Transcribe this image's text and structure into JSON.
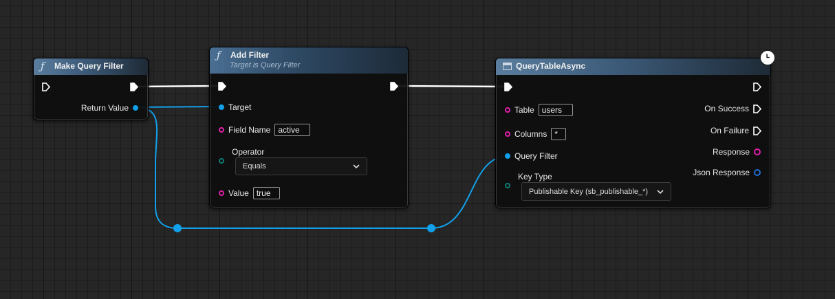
{
  "nodes": {
    "make_query_filter": {
      "title": "Make Query Filter",
      "outputs": {
        "return_value": "Return Value"
      }
    },
    "add_filter": {
      "title": "Add Filter",
      "subtitle": "Target is Query Filter",
      "inputs": {
        "target": "Target",
        "field_name": "Field Name",
        "field_name_value": "active",
        "operator": "Operator",
        "operator_value": "Equals",
        "value": "Value",
        "value_value": "true"
      }
    },
    "query_table_async": {
      "title": "QueryTableAsync",
      "inputs": {
        "table": "Table",
        "table_value": "users",
        "columns": "Columns",
        "columns_value": "*",
        "query_filter": "Query Filter",
        "key_type": "Key Type",
        "key_type_value": "Publishable Key (sb_publishable_*)"
      },
      "outputs": {
        "on_success": "On Success",
        "on_failure": "On Failure",
        "response": "Response",
        "json_response": "Json Response"
      }
    }
  },
  "colors": {
    "exec_wire": "#ffffff",
    "struct_pin": "#11a0ea",
    "string_pin": "#e020a8",
    "enum_pin": "#0f7a74",
    "object_pin": "#1f6fd6"
  },
  "icons": {
    "function": "function-icon",
    "table": "table-icon",
    "latent": "clock-icon"
  }
}
